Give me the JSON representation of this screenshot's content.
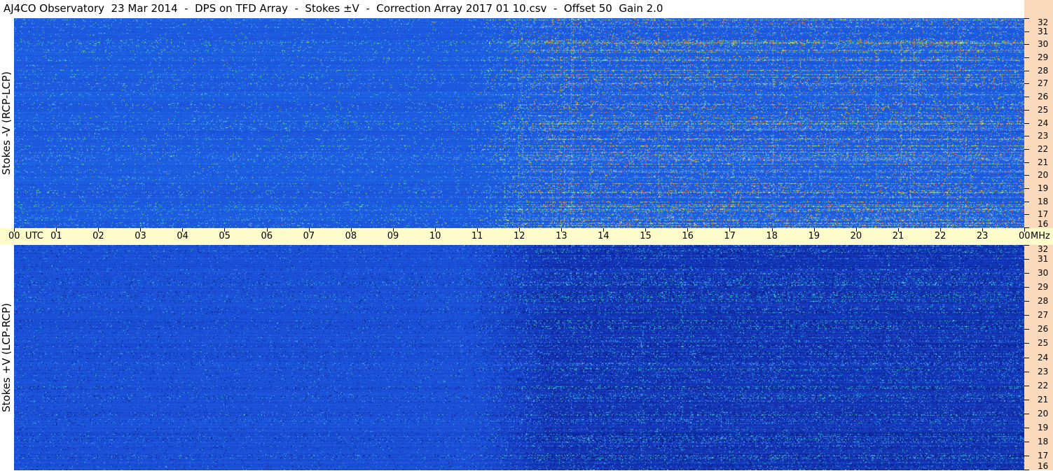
{
  "title": "AJ4CO Observatory  23 Mar 2014  -  DPS on TFD Array  -  Stokes ±V  -  Correction Array 2017 01 10.csv  -  Offset 50  Gain 2.0",
  "chart_data": {
    "type": "heatmap",
    "colormap": [
      "#000020",
      "#0a1a8a",
      "#1a46d0",
      "#1e64e6",
      "#2fa0f0",
      "#4ee6d8",
      "#9ef070",
      "#f0f050",
      "#f08c3c",
      "#e63c5a"
    ],
    "time_axis": {
      "ticks": [
        "00",
        "01",
        "02",
        "03",
        "04",
        "05",
        "06",
        "07",
        "08",
        "09",
        "10",
        "11",
        "12",
        "13",
        "14",
        "15",
        "16",
        "17",
        "18",
        "19",
        "20",
        "21",
        "22",
        "23",
        "00"
      ],
      "start_label": "UTC",
      "unit": "MHz",
      "range_hours": [
        0,
        24
      ]
    },
    "freq_axis": {
      "ticks": [
        "32",
        "31",
        "30",
        "29",
        "28",
        "27",
        "26",
        "25",
        "24",
        "23",
        "22",
        "21",
        "20",
        "19",
        "18",
        "17",
        "16"
      ],
      "range_mhz": [
        16,
        32
      ]
    },
    "panels": [
      {
        "label": "Stokes -V (RCP-LCP)",
        "variant": "minus_v"
      },
      {
        "label": "Stokes +V (LCP-RCP)",
        "variant": "plus_v"
      }
    ]
  }
}
